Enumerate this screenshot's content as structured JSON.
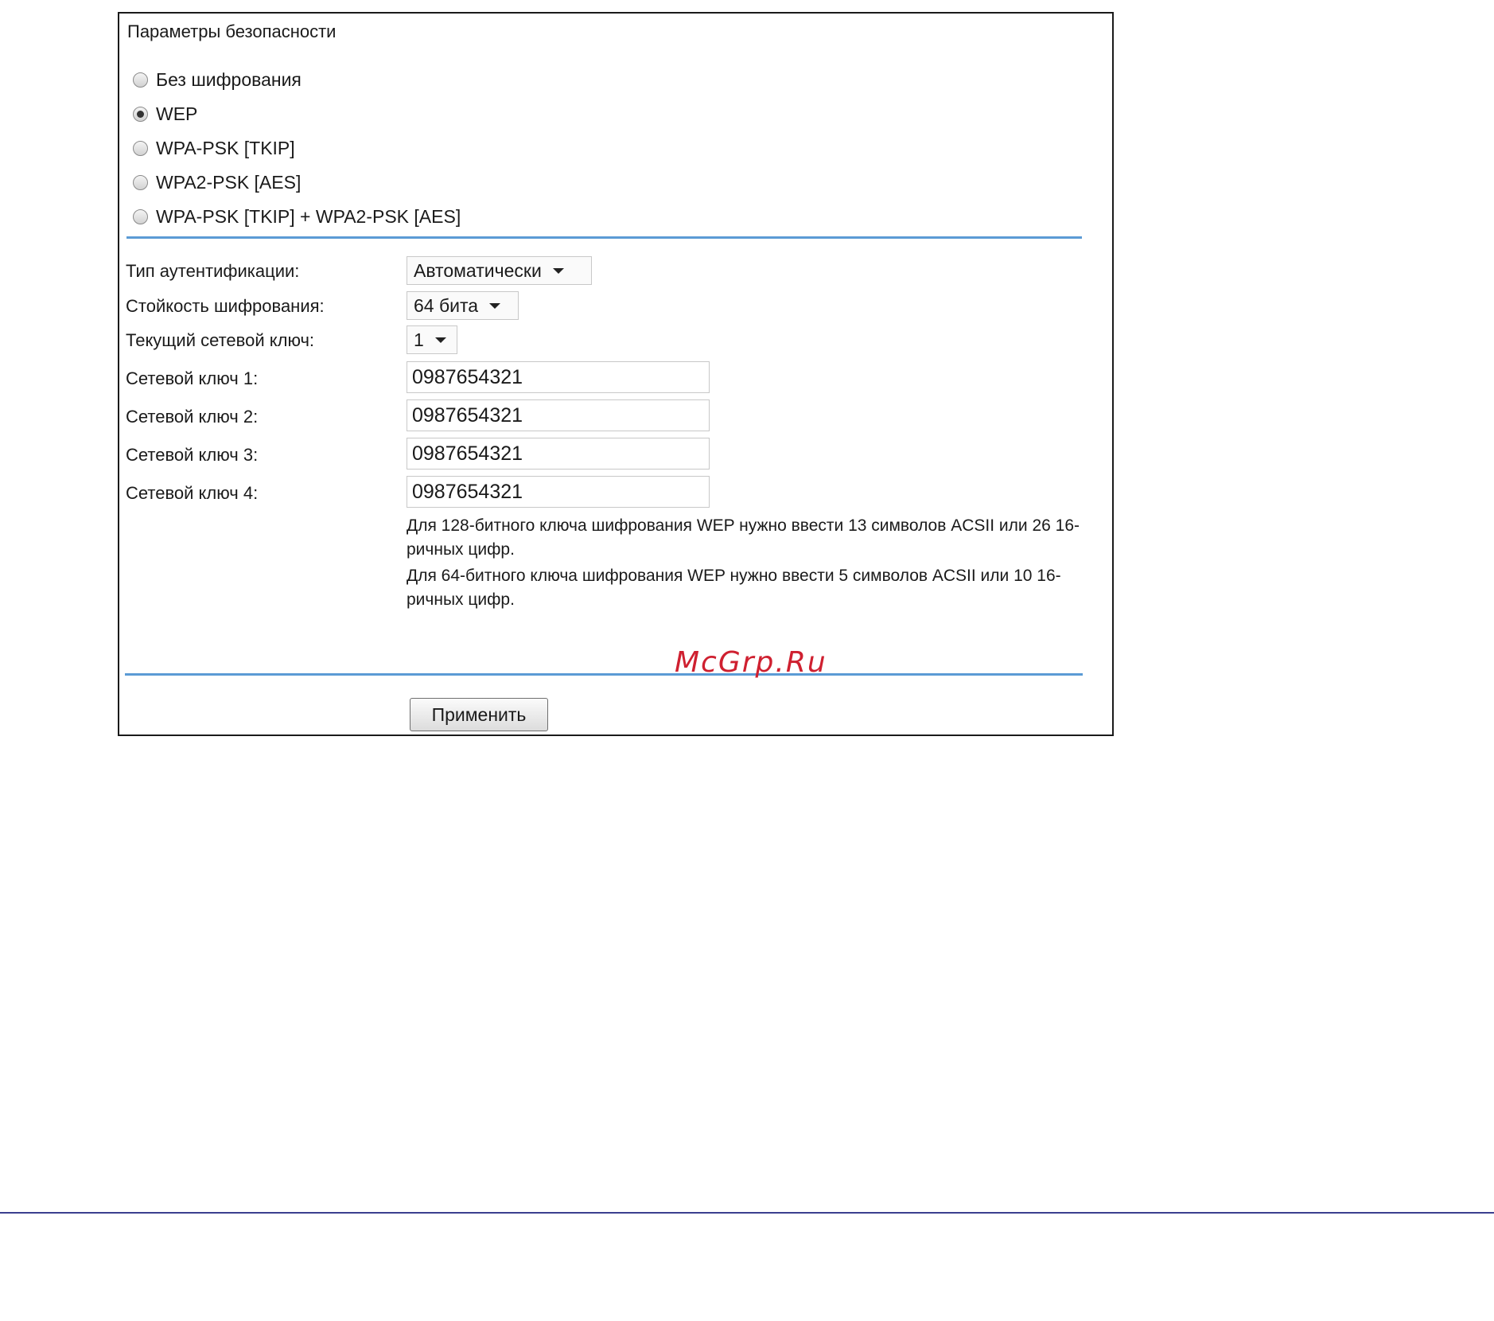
{
  "security": {
    "title": "Параметры безопасности",
    "options": [
      {
        "label": "Без шифрования",
        "checked": false
      },
      {
        "label": "WEP",
        "checked": true
      },
      {
        "label": "WPA-PSK [TKIP]",
        "checked": false
      },
      {
        "label": "WPA2-PSK [AES]",
        "checked": false
      },
      {
        "label": "WPA-PSK [TKIP] + WPA2-PSK [AES]",
        "checked": false
      }
    ]
  },
  "wep": {
    "auth_type": {
      "label": "Тип аутентификации:",
      "value": "Автоматически"
    },
    "strength": {
      "label": "Стойкость шифрования:",
      "value": "64 бита"
    },
    "current_key": {
      "label": "Текущий сетевой ключ:",
      "value": "1"
    },
    "keys": [
      {
        "label": "Сетевой ключ 1:",
        "value": "0987654321"
      },
      {
        "label": "Сетевой ключ 2:",
        "value": "0987654321"
      },
      {
        "label": "Сетевой ключ 3:",
        "value": "0987654321"
      },
      {
        "label": "Сетевой ключ 4:",
        "value": "0987654321"
      }
    ],
    "hint_128": "Для 128-битного ключа шифрования WEP нужно ввести 13 символов ACSII или 26 16-ричных цифр.",
    "hint_64": "Для 64-битного ключа шифрования WEP нужно ввести 5 символов ACSII или 10 16-ричных цифр."
  },
  "watermark": "McGrp.Ru",
  "apply_label": "Применить",
  "colors": {
    "divider": "#5b9bd5",
    "watermark": "#cf2030",
    "page_rule": "#3b3f8f"
  }
}
